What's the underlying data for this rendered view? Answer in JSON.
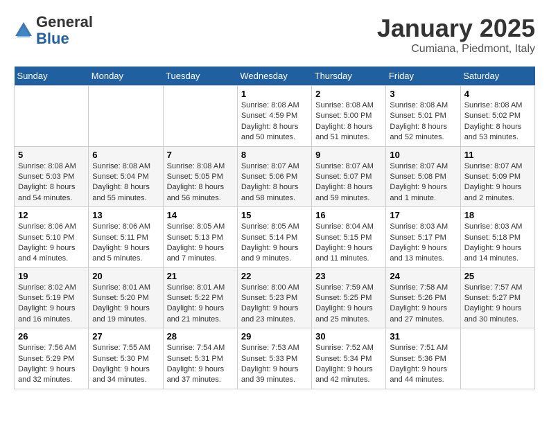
{
  "header": {
    "logo_general": "General",
    "logo_blue": "Blue",
    "month_title": "January 2025",
    "location": "Cumiana, Piedmont, Italy"
  },
  "days_of_week": [
    "Sunday",
    "Monday",
    "Tuesday",
    "Wednesday",
    "Thursday",
    "Friday",
    "Saturday"
  ],
  "weeks": [
    [
      {
        "day": "",
        "info": ""
      },
      {
        "day": "",
        "info": ""
      },
      {
        "day": "",
        "info": ""
      },
      {
        "day": "1",
        "info": "Sunrise: 8:08 AM\nSunset: 4:59 PM\nDaylight: 8 hours\nand 50 minutes."
      },
      {
        "day": "2",
        "info": "Sunrise: 8:08 AM\nSunset: 5:00 PM\nDaylight: 8 hours\nand 51 minutes."
      },
      {
        "day": "3",
        "info": "Sunrise: 8:08 AM\nSunset: 5:01 PM\nDaylight: 8 hours\nand 52 minutes."
      },
      {
        "day": "4",
        "info": "Sunrise: 8:08 AM\nSunset: 5:02 PM\nDaylight: 8 hours\nand 53 minutes."
      }
    ],
    [
      {
        "day": "5",
        "info": "Sunrise: 8:08 AM\nSunset: 5:03 PM\nDaylight: 8 hours\nand 54 minutes."
      },
      {
        "day": "6",
        "info": "Sunrise: 8:08 AM\nSunset: 5:04 PM\nDaylight: 8 hours\nand 55 minutes."
      },
      {
        "day": "7",
        "info": "Sunrise: 8:08 AM\nSunset: 5:05 PM\nDaylight: 8 hours\nand 56 minutes."
      },
      {
        "day": "8",
        "info": "Sunrise: 8:07 AM\nSunset: 5:06 PM\nDaylight: 8 hours\nand 58 minutes."
      },
      {
        "day": "9",
        "info": "Sunrise: 8:07 AM\nSunset: 5:07 PM\nDaylight: 8 hours\nand 59 minutes."
      },
      {
        "day": "10",
        "info": "Sunrise: 8:07 AM\nSunset: 5:08 PM\nDaylight: 9 hours\nand 1 minute."
      },
      {
        "day": "11",
        "info": "Sunrise: 8:07 AM\nSunset: 5:09 PM\nDaylight: 9 hours\nand 2 minutes."
      }
    ],
    [
      {
        "day": "12",
        "info": "Sunrise: 8:06 AM\nSunset: 5:10 PM\nDaylight: 9 hours\nand 4 minutes."
      },
      {
        "day": "13",
        "info": "Sunrise: 8:06 AM\nSunset: 5:11 PM\nDaylight: 9 hours\nand 5 minutes."
      },
      {
        "day": "14",
        "info": "Sunrise: 8:05 AM\nSunset: 5:13 PM\nDaylight: 9 hours\nand 7 minutes."
      },
      {
        "day": "15",
        "info": "Sunrise: 8:05 AM\nSunset: 5:14 PM\nDaylight: 9 hours\nand 9 minutes."
      },
      {
        "day": "16",
        "info": "Sunrise: 8:04 AM\nSunset: 5:15 PM\nDaylight: 9 hours\nand 11 minutes."
      },
      {
        "day": "17",
        "info": "Sunrise: 8:03 AM\nSunset: 5:17 PM\nDaylight: 9 hours\nand 13 minutes."
      },
      {
        "day": "18",
        "info": "Sunrise: 8:03 AM\nSunset: 5:18 PM\nDaylight: 9 hours\nand 14 minutes."
      }
    ],
    [
      {
        "day": "19",
        "info": "Sunrise: 8:02 AM\nSunset: 5:19 PM\nDaylight: 9 hours\nand 16 minutes."
      },
      {
        "day": "20",
        "info": "Sunrise: 8:01 AM\nSunset: 5:20 PM\nDaylight: 9 hours\nand 19 minutes."
      },
      {
        "day": "21",
        "info": "Sunrise: 8:01 AM\nSunset: 5:22 PM\nDaylight: 9 hours\nand 21 minutes."
      },
      {
        "day": "22",
        "info": "Sunrise: 8:00 AM\nSunset: 5:23 PM\nDaylight: 9 hours\nand 23 minutes."
      },
      {
        "day": "23",
        "info": "Sunrise: 7:59 AM\nSunset: 5:25 PM\nDaylight: 9 hours\nand 25 minutes."
      },
      {
        "day": "24",
        "info": "Sunrise: 7:58 AM\nSunset: 5:26 PM\nDaylight: 9 hours\nand 27 minutes."
      },
      {
        "day": "25",
        "info": "Sunrise: 7:57 AM\nSunset: 5:27 PM\nDaylight: 9 hours\nand 30 minutes."
      }
    ],
    [
      {
        "day": "26",
        "info": "Sunrise: 7:56 AM\nSunset: 5:29 PM\nDaylight: 9 hours\nand 32 minutes."
      },
      {
        "day": "27",
        "info": "Sunrise: 7:55 AM\nSunset: 5:30 PM\nDaylight: 9 hours\nand 34 minutes."
      },
      {
        "day": "28",
        "info": "Sunrise: 7:54 AM\nSunset: 5:31 PM\nDaylight: 9 hours\nand 37 minutes."
      },
      {
        "day": "29",
        "info": "Sunrise: 7:53 AM\nSunset: 5:33 PM\nDaylight: 9 hours\nand 39 minutes."
      },
      {
        "day": "30",
        "info": "Sunrise: 7:52 AM\nSunset: 5:34 PM\nDaylight: 9 hours\nand 42 minutes."
      },
      {
        "day": "31",
        "info": "Sunrise: 7:51 AM\nSunset: 5:36 PM\nDaylight: 9 hours\nand 44 minutes."
      },
      {
        "day": "",
        "info": ""
      }
    ]
  ]
}
